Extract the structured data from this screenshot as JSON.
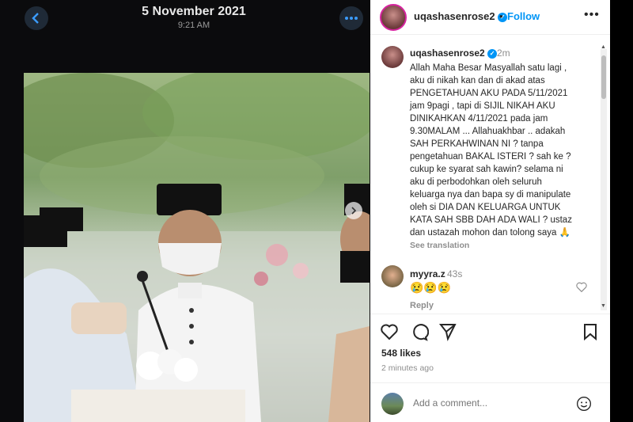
{
  "viewer": {
    "date": "5 November 2021",
    "time": "9:21 AM"
  },
  "post": {
    "username": "uqashasenrose2",
    "follow_label": "Follow",
    "caption_ago": "2m",
    "caption_text": "Allah Maha Besar Masyallah satu lagi ,\naku di nikah kan dan di akad atas\nPENGETAHUAN AKU PADA 5/11/2021\njam 9pagi , tapi di SIJIL NIKAH AKU\nDINIKAHKAN 4/11/2021 pada jam\n9.30MALAM ... Allahuakhbar .. adakah\nSAH PERKAHWINAN NI ? tanpa\npengetahuan BAKAL ISTERI ? sah ke ?\ncukup ke syarat sah kawin? selama ni\naku di perbodohkan oleh seluruh\nkeluarga nya dan bapa sy di manipulate\noleh si DIA DAN KELUARGA UNTUK\nKATA SAH SBB DAH ADA WALI ?  ustaz\ndan ustazah mohon dan tolong saya 🙏",
    "see_translation": "See translation",
    "likes": "548 likes",
    "posted_ago": "2 minutes ago"
  },
  "comments": [
    {
      "username": "myyra.z",
      "ago": "43s",
      "text": "😢😢😢",
      "reply_label": "Reply"
    }
  ],
  "add_comment": {
    "placeholder": "Add a comment..."
  },
  "colors": {
    "accent": "#0095f6",
    "viewer_bg": "#0b0b0d",
    "button_bg": "#1f2a37"
  },
  "icons": [
    "back-icon",
    "more-icon",
    "verified-icon",
    "heart-icon",
    "comment-icon",
    "share-icon",
    "bookmark-icon",
    "emoji-icon",
    "chevron-right-icon"
  ]
}
